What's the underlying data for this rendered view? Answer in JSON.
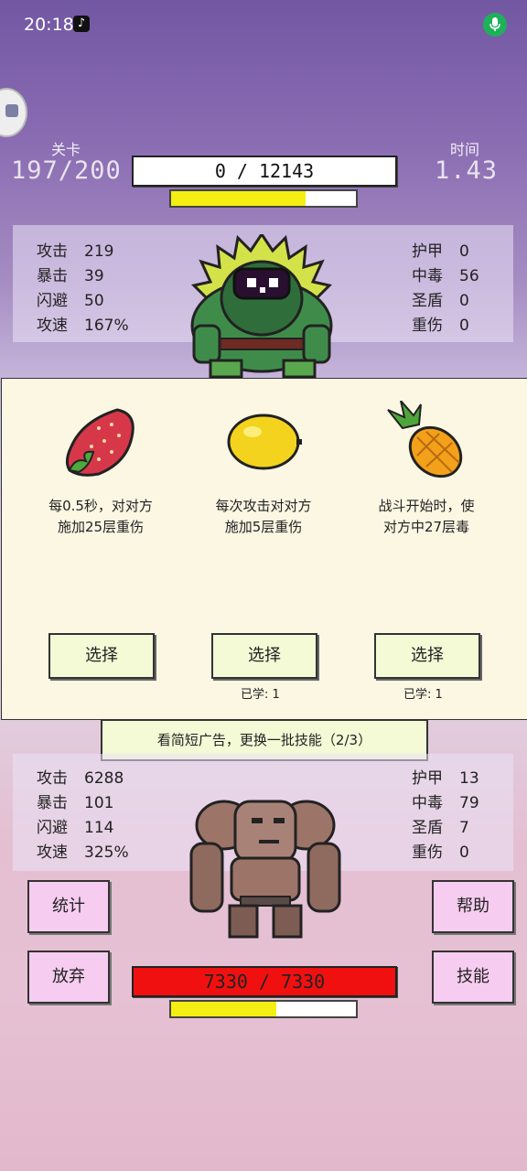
{
  "status_bar": {
    "time": "20:18"
  },
  "header": {
    "level_label": "关卡",
    "level_value": "197/200",
    "time_label": "时间",
    "time_value": "1.43",
    "enemy_hp": "0 / 12143",
    "enemy_bar_fill": 0.73
  },
  "enemy_stats": {
    "left": [
      {
        "k": "攻击",
        "v": "219"
      },
      {
        "k": "暴击",
        "v": "39"
      },
      {
        "k": "闪避",
        "v": "50"
      },
      {
        "k": "攻速",
        "v": "167%"
      }
    ],
    "right": [
      {
        "k": "护甲",
        "v": "0"
      },
      {
        "k": "中毒",
        "v": "56"
      },
      {
        "k": "圣盾",
        "v": "0"
      },
      {
        "k": "重伤",
        "v": "0"
      }
    ]
  },
  "skills": [
    {
      "icon": "strawberry-icon",
      "line1": "每0.5秒，对对方",
      "line2": "施加25层重伤",
      "button": "选择",
      "learned": ""
    },
    {
      "icon": "lemon-icon",
      "line1": "每次攻击对对方",
      "line2": "施加5层重伤",
      "button": "选择",
      "learned": "已学: 1"
    },
    {
      "icon": "pineapple-icon",
      "line1": "战斗开始时，使",
      "line2": "对方中27层毒",
      "button": "选择",
      "learned": "已学: 1"
    }
  ],
  "ad_button": "看简短广告，更换一批技能（2/3）",
  "player_stats": {
    "left": [
      {
        "k": "攻击",
        "v": "6288"
      },
      {
        "k": "暴击",
        "v": "101"
      },
      {
        "k": "闪避",
        "v": "114"
      },
      {
        "k": "攻速",
        "v": "325%"
      }
    ],
    "right": [
      {
        "k": "护甲",
        "v": "13"
      },
      {
        "k": "中毒",
        "v": "79"
      },
      {
        "k": "圣盾",
        "v": "7"
      },
      {
        "k": "重伤",
        "v": "0"
      }
    ]
  },
  "player": {
    "hp": "7330 / 7330",
    "bar_fill": 0.57
  },
  "buttons": {
    "stats": "统计",
    "help": "帮助",
    "give_up": "放弃",
    "skills": "技能"
  }
}
